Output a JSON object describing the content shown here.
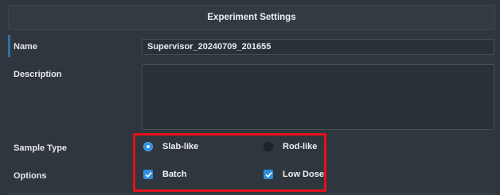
{
  "header": {
    "title": "Experiment Settings"
  },
  "form": {
    "name_label": "Name",
    "name_value": "Supervisor_20240709_201655",
    "description_label": "Description",
    "description_value": "",
    "sample_type_label": "Sample Type",
    "sample_type_options": [
      {
        "label": "Slab-like",
        "selected": true
      },
      {
        "label": "Rod-like",
        "selected": false
      }
    ],
    "options_label": "Options",
    "options": [
      {
        "label": "Batch",
        "checked": true
      },
      {
        "label": "Low Dose",
        "checked": true
      }
    ]
  },
  "colors": {
    "accent": "#2f8fe0",
    "highlight": "#e3101b",
    "background": "#2f363d"
  }
}
